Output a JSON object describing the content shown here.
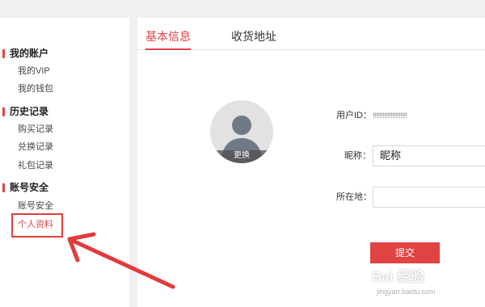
{
  "sidebar": {
    "groups": [
      {
        "title": "我的账户",
        "items": [
          "我的VIP",
          "我的钱包"
        ]
      },
      {
        "title": "历史记录",
        "items": [
          "购买记录",
          "兑换记录",
          "礼包记录"
        ]
      },
      {
        "title": "账号安全",
        "items": [
          "账号安全",
          "个人资料"
        ]
      }
    ],
    "active_item": "个人资料"
  },
  "tabs": [
    {
      "label": "基本信息",
      "active": true
    },
    {
      "label": "收货地址",
      "active": false
    }
  ],
  "profile": {
    "avatar_change_label": "更换",
    "uid_label": "用户ID：",
    "uid_value": "!!!!!!!!!!!!!!!!!!!!!",
    "nickname_label": "昵称：",
    "nickname_value": "昵称",
    "location_label": "所在地：",
    "location_value": "",
    "submit_label": "提交"
  },
  "watermark": {
    "logo": "Bai 经验",
    "url": "jingyan.baidu.com"
  },
  "colors": {
    "accent": "#e14343",
    "annotation": "#e23b3b"
  }
}
